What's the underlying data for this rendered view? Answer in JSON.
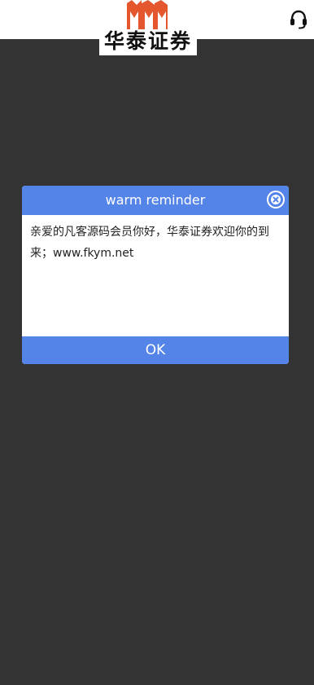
{
  "header": {
    "logo_text": "华泰证券",
    "brand_color": "#e4572e",
    "support_icon": "headset-icon"
  },
  "dialog": {
    "title": "warm reminder",
    "message": "亲爱的凡客源码会员你好，华泰证券欢迎你的到来；www.fkym.net",
    "ok_label": "OK",
    "close_icon": "close-circle-icon",
    "accent_color": "#5584e8"
  },
  "page": {
    "background_color": "#333333"
  }
}
